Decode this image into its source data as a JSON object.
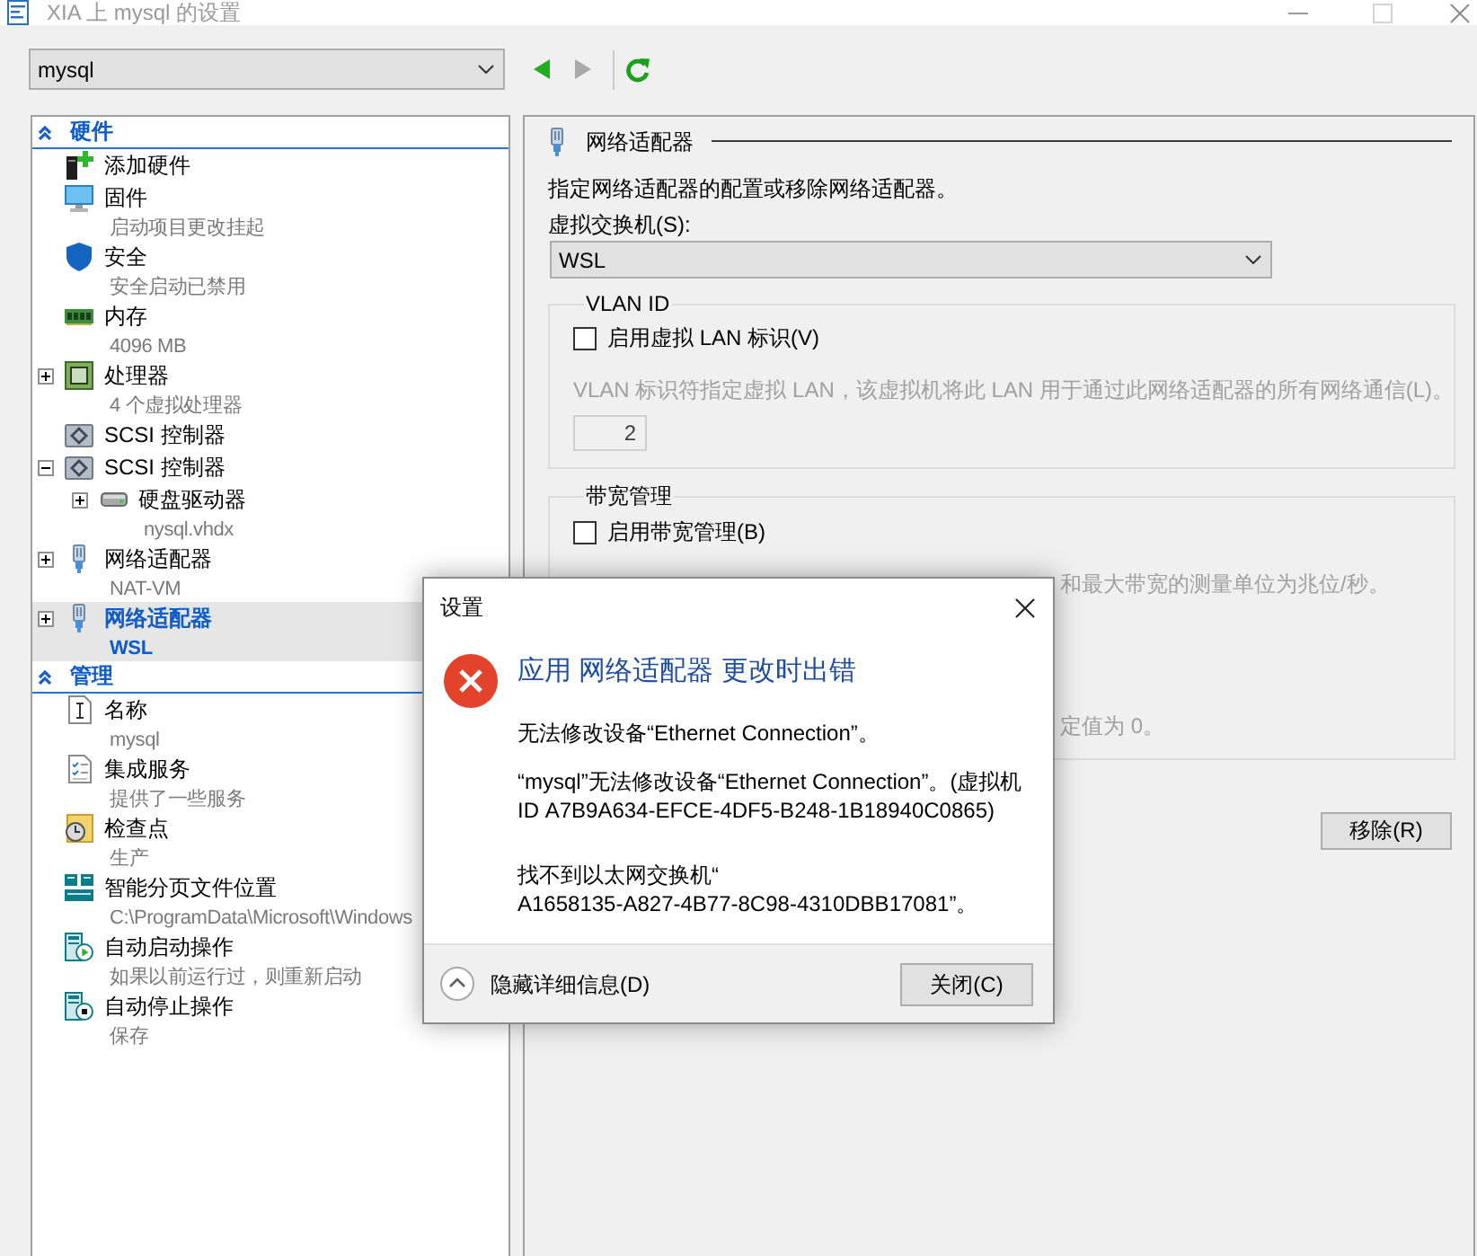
{
  "window": {
    "title": "XIA 上 mysql 的设置"
  },
  "toolbar": {
    "vm_select": {
      "value": "mysql"
    },
    "back": {
      "disabled": false
    },
    "forward": {
      "disabled": true
    }
  },
  "sidebar": {
    "sections": [
      {
        "title": "硬件",
        "expanded": true,
        "items": [
          {
            "kind": "hardware",
            "label": "添加硬件",
            "selected": false
          },
          {
            "kind": "firmware",
            "label": "固件",
            "detail": "启动项目更改挂起",
            "selected": false
          },
          {
            "kind": "security",
            "label": "安全",
            "detail": "安全启动已禁用",
            "selected": false
          },
          {
            "kind": "memory",
            "label": "内存",
            "detail": "4096 MB",
            "selected": false
          },
          {
            "kind": "processor",
            "label": "处理器",
            "detail": "4 个虚拟处理器",
            "expanded": false,
            "selected": false
          },
          {
            "kind": "scsi",
            "label": "SCSI 控制器",
            "selected": false
          },
          {
            "kind": "scsi",
            "label": "SCSI 控制器",
            "expanded": true,
            "selected": false,
            "children": [
              {
                "kind": "disk",
                "label": "硬盘驱动器",
                "detail": "nysql.vhdx",
                "expanded": false,
                "selected": false
              }
            ]
          },
          {
            "kind": "network",
            "label": "网络适配器",
            "detail": "NAT-VM",
            "expanded": false,
            "selected": false
          },
          {
            "kind": "network",
            "label": "网络适配器",
            "detail": "WSL",
            "expanded": false,
            "selected": true
          }
        ]
      },
      {
        "title": "管理",
        "expanded": true,
        "items": [
          {
            "kind": "name",
            "label": "名称",
            "detail": "mysql",
            "selected": false
          },
          {
            "kind": "services",
            "label": "集成服务",
            "detail": "提供了一些服务",
            "selected": false
          },
          {
            "kind": "checkpoint",
            "label": "检查点",
            "detail": "生产",
            "selected": false
          },
          {
            "kind": "paging",
            "label": "智能分页文件位置",
            "detail": "C:\\ProgramData\\Microsoft\\Windows",
            "selected": false
          },
          {
            "kind": "autostart",
            "label": "自动启动操作",
            "detail": "如果以前运行过，则重新启动",
            "selected": false
          },
          {
            "kind": "autostop",
            "label": "自动停止操作",
            "detail": "保存",
            "selected": false
          }
        ]
      }
    ]
  },
  "details": {
    "title": "网络适配器",
    "description": "指定网络适配器的配置或移除网络适配器。",
    "switch": {
      "label": "虚拟交换机(S):",
      "value": "WSL"
    },
    "vlan": {
      "title": "VLAN ID",
      "enable": {
        "label": "启用虚拟 LAN 标识(V)",
        "checked": false
      },
      "note": {
        "text": "VLAN 标识符指定虚拟 LAN，该虚拟机将此 LAN 用于通过此网络适配器的所有网络通信(L)。",
        "disabled": true
      },
      "id_field": {
        "value": "2",
        "disabled": true
      }
    },
    "bandwidth": {
      "title": "带宽管理",
      "enable": {
        "label": "启用带宽管理(B)",
        "checked": false
      },
      "note_fragments": [
        {
          "text": "和最大带宽的测量单位为兆位/秒。",
          "disabled": true
        },
        {
          "text": "定值为 0。",
          "disabled": true
        }
      ]
    },
    "buttons": [
      {
        "label": "移除(R)"
      }
    ]
  },
  "dialog": {
    "title": "设置",
    "heading": "应用 网络适配器 更改时出错",
    "messages": [
      "无法修改设备“Ethernet Connection”。",
      "“mysql”无法修改设备“Ethernet Connection”。(虚拟机 ID A7B9A634-EFCE-4DF5-B248-1B18940C0865)",
      "找不到以太网交换机“A1658135-A827-4B77-8C98-4310DBB17081”。"
    ],
    "details_toggle": {
      "label": "隐藏详细信息(D)",
      "expanded": true
    },
    "buttons": [
      {
        "label": "关闭(C)"
      }
    ]
  }
}
